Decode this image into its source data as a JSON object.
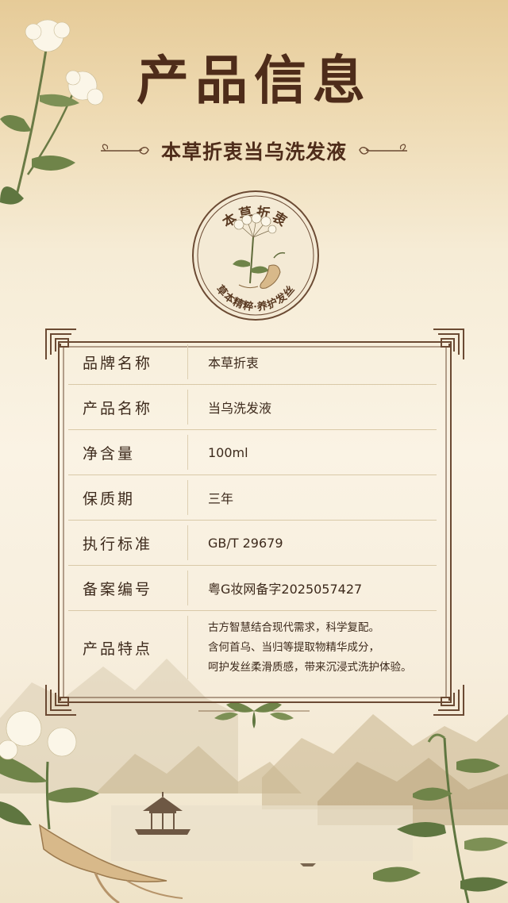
{
  "page_title": "产品信息",
  "subtitle": "本草折衷当乌洗发液",
  "emblem": {
    "top_text": "本草折衷",
    "bottom_text": "草本精粹·养护发丝"
  },
  "table": {
    "rows": [
      {
        "label": "品牌名称",
        "value": "本草折衷"
      },
      {
        "label": "产品名称",
        "value": "当乌洗发液"
      },
      {
        "label": "净含量",
        "value": "100ml"
      },
      {
        "label": "保质期",
        "value": "三年"
      },
      {
        "label": "执行标准",
        "value": "GB/T 29679"
      },
      {
        "label": "备案编号",
        "value": "粤G妆网备字2025057427"
      }
    ],
    "feature_label": "产品特点",
    "feature_lines": [
      "古方智慧结合现代需求，科学复配。",
      "含何首乌、当归等提取物精华成分，",
      "呵护发丝柔滑质感，带来沉浸式洗护体验。"
    ]
  },
  "colors": {
    "title": "#4e2c1a",
    "frame": "#6b4a33",
    "divider": "#d9c9a8",
    "background_top": "#e6cb98",
    "background_mid": "#faf3e4"
  }
}
